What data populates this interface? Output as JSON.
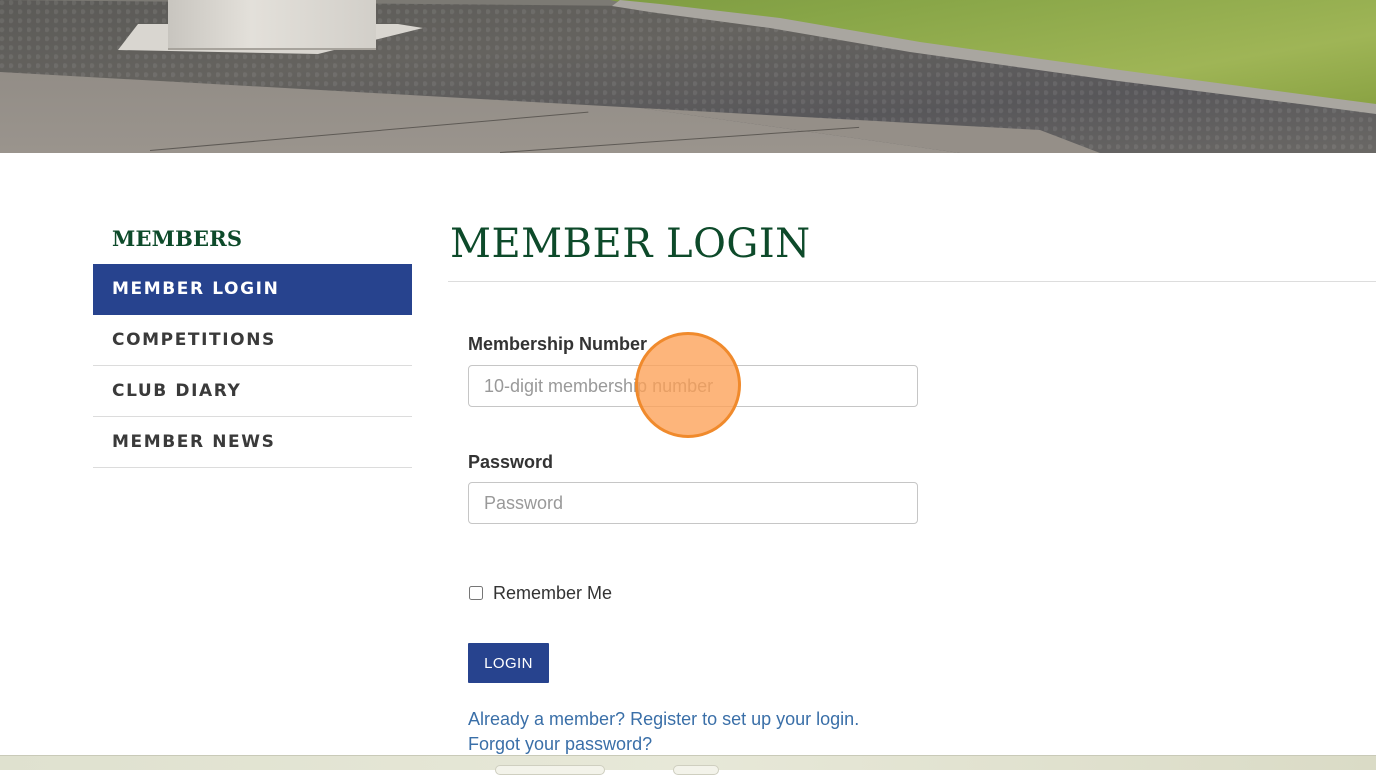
{
  "hero": {
    "image_name": "clubhouse-grounds-photo"
  },
  "sidebar": {
    "heading": "MEMBERS",
    "items": [
      {
        "label": "MEMBER LOGIN",
        "active": true
      },
      {
        "label": "COMPETITIONS",
        "active": false
      },
      {
        "label": "CLUB DIARY",
        "active": false
      },
      {
        "label": "MEMBER NEWS",
        "active": false
      }
    ]
  },
  "main": {
    "title": "MEMBER LOGIN",
    "form": {
      "membership_label": "Membership Number",
      "membership_value": "",
      "membership_placeholder": "10-digit membership number",
      "password_label": "Password",
      "password_value": "",
      "password_placeholder": "Password",
      "remember_label": "Remember Me",
      "remember_checked": false,
      "login_button": "LOGIN"
    },
    "links": {
      "register": "Already a member? Register to set up your login.",
      "forgot": "Forgot your password?"
    }
  },
  "colors": {
    "brand_green": "#0d4a2a",
    "brand_blue": "#27438e",
    "link_blue": "#3a6fa8",
    "click_marker": "#fca056"
  }
}
